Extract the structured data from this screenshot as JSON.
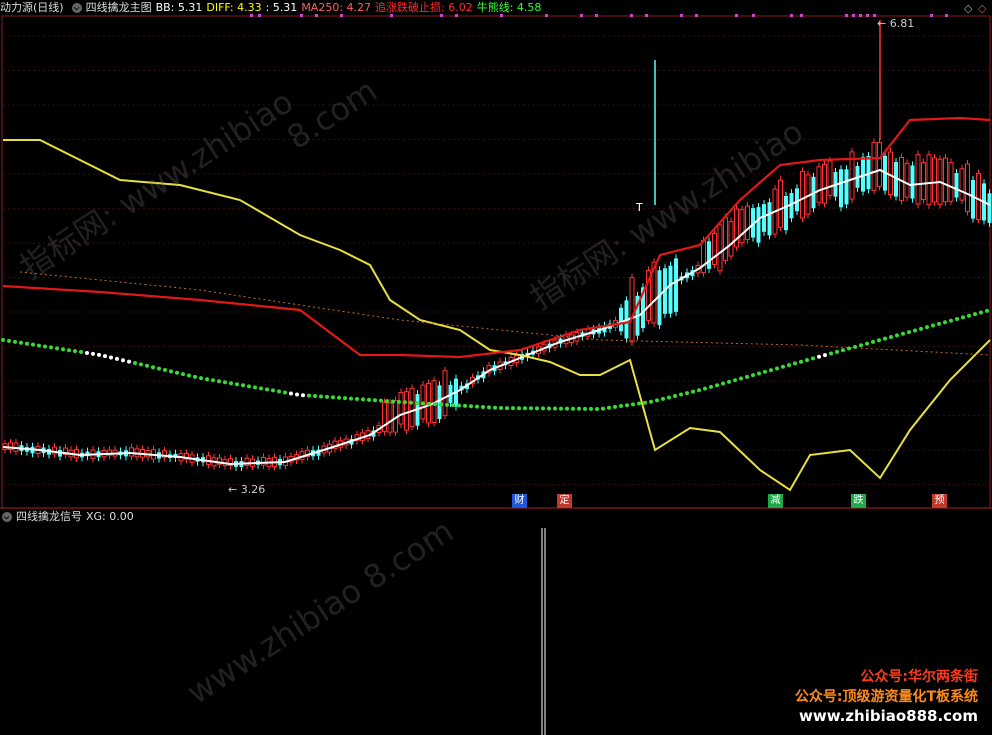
{
  "main_panel": {
    "title": "动力源(日线)",
    "indicator": "四线擒龙主图",
    "values": [
      {
        "text": "BB: 5.31",
        "color": "#ffffff"
      },
      {
        "text": "DIFF: 4.33",
        "color": "#ffff00"
      },
      {
        "text": ": 5.31",
        "color": "#ffffff"
      },
      {
        "text": "MA250: 4.27",
        "color": "#ff5555"
      },
      {
        "text": "追涨跌破止损: 6.02",
        "color": "#ff3333"
      },
      {
        "text": "牛熊线: 4.58",
        "color": "#33ff33"
      }
    ],
    "high_label": "6.81",
    "low_label": "3.26",
    "t_label": "T",
    "events": [
      {
        "text": "财",
        "bg": "#1e56d8",
        "color": "#ffffff"
      },
      {
        "text": "定",
        "bg": "#c0392b",
        "color": "#ffffff"
      },
      {
        "text": "减",
        "bg": "#20a94a",
        "color": "#ffffff"
      },
      {
        "text": "跌",
        "bg": "#20a94a",
        "color": "#ffffff"
      },
      {
        "text": "预",
        "bg": "#c0392b",
        "color": "#ffffff"
      }
    ]
  },
  "sub_panel": {
    "indicator": "四线擒龙信号",
    "value": "XG: 0.00"
  },
  "corner_icons": [
    "expand-icon",
    "collapse-icon"
  ],
  "watermark": {
    "cn": "指标网:",
    "url": "www.zhibiao",
    "url2": "8.com"
  },
  "promo": {
    "line1": "公众号:华尔两条街",
    "line2": "公众号:顶级游资量化T板系统",
    "line3": "www.zhibiao888.com"
  },
  "colors": {
    "up": "#ff3333",
    "down": "#54ffff",
    "white_line": "#ffffff",
    "yellow_line": "#e8e040",
    "red_line": "#e01818",
    "green_dots": "#33dd33"
  }
}
